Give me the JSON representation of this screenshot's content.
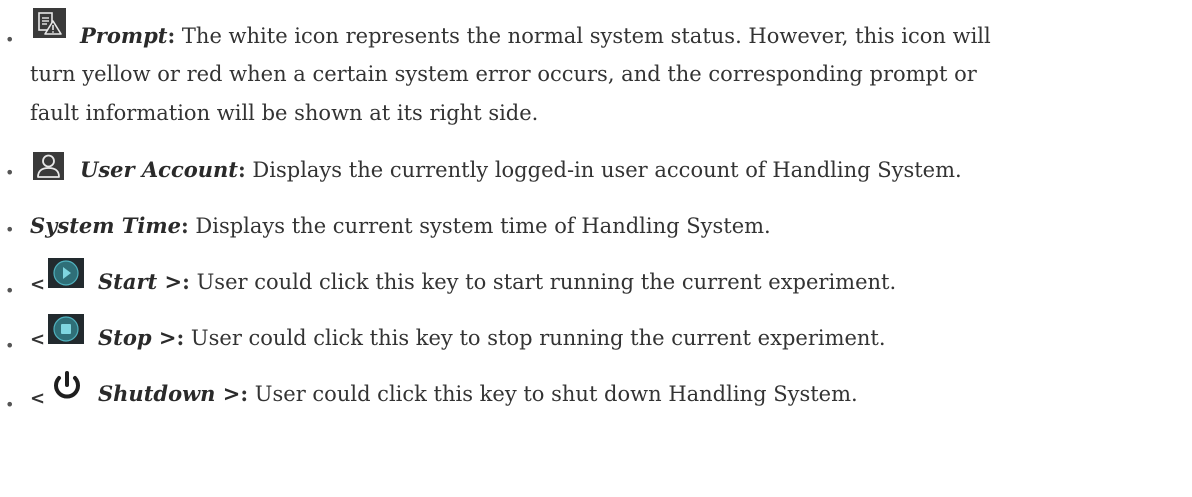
{
  "items": [
    {
      "icon": "prompt-warning-icon",
      "term": "Prompt",
      "colon": ":",
      "lines": [
        " The white icon represents the normal system status. However, this icon will",
        "turn yellow or red when a certain system error occurs, and the corresponding prompt or",
        "fault information will be shown at its right side."
      ]
    },
    {
      "icon": "user-icon",
      "term": "User Account",
      "colon": ":",
      "text": " Displays the currently logged-in user account of Handling System."
    },
    {
      "term": "System Time",
      "colon": ":",
      "text": " Displays the current system time of Handling System."
    },
    {
      "prefix": "<",
      "icon": "play-icon",
      "term": "Start >",
      "colon": ":",
      "text": " User could click this key to start running the current experiment."
    },
    {
      "prefix": "<",
      "icon": "stop-icon",
      "term": "Stop >",
      "colon": ":",
      "text": " User could click this key to stop running the current experiment."
    },
    {
      "prefix": "<",
      "icon": "power-icon",
      "term": "Shutdown >",
      "colon": ":",
      "text": " User could click this key to shut down Handling System."
    }
  ],
  "bullet": "•"
}
